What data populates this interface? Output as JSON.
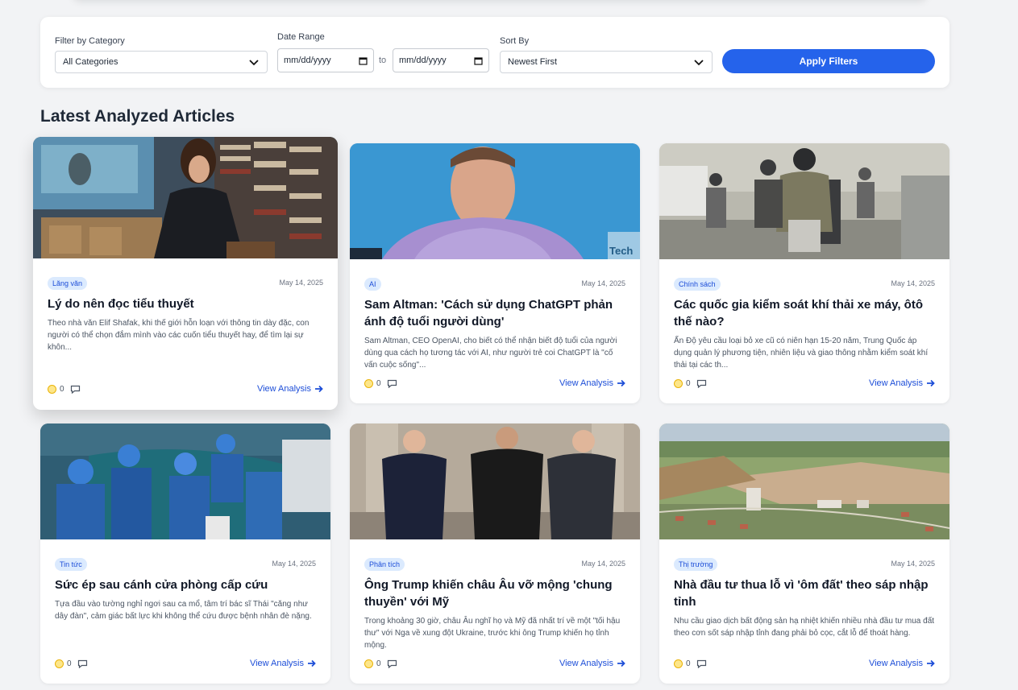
{
  "filters": {
    "category_label": "Filter by Category",
    "category_value": "All Categories",
    "date_label": "Date Range",
    "date_from_placeholder": "mm/dd/yyyy",
    "date_to_word": "to",
    "date_to_placeholder": "mm/dd/yyyy",
    "sort_label": "Sort By",
    "sort_value": "Newest First",
    "apply_label": "Apply Filters"
  },
  "section_title": "Latest Analyzed Articles",
  "articles": [
    {
      "badge": "Lăng văn",
      "date": "May 14, 2025",
      "title": "Lý do nên đọc tiểu thuyết",
      "excerpt": "Theo nhà văn Elif Shafak, khi thế giới hỗn loạn với thông tin dày đặc, con người có thể chọn đắm mình vào các cuốn tiểu thuyết hay, để tìm lại sự khôn...",
      "reactions": "0",
      "view_label": "View Analysis"
    },
    {
      "badge": "AI",
      "date": "May 14, 2025",
      "title": "Sam Altman: 'Cách sử dụng ChatGPT phản ánh độ tuổi người dùng'",
      "excerpt": "Sam Altman, CEO OpenAI, cho biết có thể nhận biết độ tuổi của người dùng qua cách họ tương tác với AI, như người trẻ coi ChatGPT là \"cố vấn cuộc sống\"...",
      "reactions": "0",
      "view_label": "View Analysis"
    },
    {
      "badge": "Chính sách",
      "date": "May 14, 2025",
      "title": "Các quốc gia kiểm soát khí thải xe máy, ôtô thế nào?",
      "excerpt": "Ấn Độ yêu cầu loại bỏ xe cũ có niên hạn 15-20 năm, Trung Quốc áp dụng quản lý phương tiện, nhiên liệu và giao thông nhằm kiểm soát khí thải tại các th...",
      "reactions": "0",
      "view_label": "View Analysis"
    },
    {
      "badge": "Tin tức",
      "date": "May 14, 2025",
      "title": "Sức ép sau cánh cửa phòng cấp cứu",
      "excerpt": "Tựa đầu vào tường nghỉ ngơi sau ca mổ, tâm trí bác sĩ Thái \"căng như dây đàn\", cảm giác bất lực khi không thể cứu được bệnh nhân đè nặng.",
      "reactions": "0",
      "view_label": "View Analysis"
    },
    {
      "badge": "Phân tích",
      "date": "May 14, 2025",
      "title": "Ông Trump khiến châu Âu vỡ mộng 'chung thuyền' với Mỹ",
      "excerpt": "Trong khoảng 30 giờ, châu Âu nghĩ họ và Mỹ đã nhất trí về một \"tối hậu thư\" với Nga về xung đột Ukraine, trước khi ông Trump khiến họ tỉnh mộng.",
      "reactions": "0",
      "view_label": "View Analysis"
    },
    {
      "badge": "Thị trường",
      "date": "May 14, 2025",
      "title": "Nhà đầu tư thua lỗ vì 'ôm đất' theo sáp nhập tỉnh",
      "excerpt": "Nhu cầu giao dịch bất động sản hạ nhiệt khiến nhiều nhà đầu tư mua đất theo cơn sốt sáp nhập tỉnh đang phải bỏ cọc, cắt lỗ để thoát hàng.",
      "reactions": "0",
      "view_label": "View Analysis"
    }
  ],
  "icons": {
    "chevron": "chevron-down-icon",
    "calendar": "calendar-icon",
    "reaction": "smile-icon",
    "comment": "comment-icon",
    "arrow": "arrow-right-icon"
  },
  "colors": {
    "accent": "#2563eb",
    "badge_bg": "#dbeafe",
    "badge_text": "#1d4ed8",
    "background": "#f2f3f5"
  }
}
